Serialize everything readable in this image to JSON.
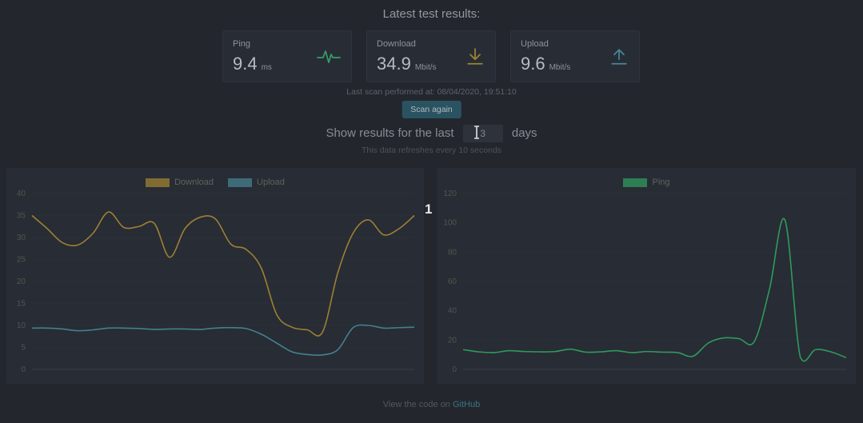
{
  "page": {
    "title": "Latest test results:",
    "last_scan": "Last scan performed at: 08/04/2020, 19:51:10",
    "scan_button": "Scan again",
    "filter_prefix": "Show results for the last",
    "filter_days_value": "3",
    "filter_suffix": "days",
    "refresh_note": "This data refreshes every 10 seconds",
    "annotation": "1",
    "footer_text": "View the code on",
    "footer_link": "GitHub"
  },
  "cards": [
    {
      "label": "Ping",
      "value": "9.4",
      "unit": "ms",
      "icon": "pulse-icon",
      "icon_color": "#35a065"
    },
    {
      "label": "Download",
      "value": "34.9",
      "unit": "Mbit/s",
      "icon": "download-icon",
      "icon_color": "#a08431"
    },
    {
      "label": "Upload",
      "value": "9.6",
      "unit": "Mbit/s",
      "icon": "upload-icon",
      "icon_color": "#46879a"
    }
  ],
  "colors": {
    "background": "#23272d",
    "panel": "#282c34",
    "download": "#9d8033",
    "upload": "#44808f",
    "ping": "#2f9a5e",
    "link": "#3c7484"
  },
  "chart_data": [
    {
      "type": "line",
      "title": "",
      "legend_position": "top",
      "x_axis_labels_visible": false,
      "grid": "faint-horizontal",
      "ylim": [
        0,
        40
      ],
      "yticks": [
        0,
        5,
        10,
        15,
        20,
        25,
        30,
        35,
        40
      ],
      "series": [
        {
          "name": "Download",
          "color": "#9d8033",
          "values": [
            35,
            32,
            28.8,
            28.3,
            31,
            35.8,
            32.3,
            32.5,
            33.2,
            25.5,
            32,
            34.6,
            34.2,
            28.5,
            27.3,
            23,
            12.5,
            9.6,
            9,
            8.5,
            22,
            31,
            34,
            30.6,
            32,
            35
          ]
        },
        {
          "name": "Upload",
          "color": "#44808f",
          "values": [
            9.4,
            9.4,
            9.2,
            8.8,
            9,
            9.4,
            9.4,
            9.3,
            9.1,
            9.2,
            9.2,
            9.1,
            9.4,
            9.5,
            9.3,
            8,
            6,
            4,
            3.4,
            3.3,
            4.5,
            9.5,
            10,
            9.4,
            9.5,
            9.6
          ]
        }
      ]
    },
    {
      "type": "line",
      "title": "",
      "legend_position": "top",
      "x_axis_labels_visible": false,
      "grid": "faint-horizontal",
      "ylim": [
        0,
        120
      ],
      "yticks": [
        0,
        20,
        40,
        60,
        80,
        100,
        120
      ],
      "series": [
        {
          "name": "Ping",
          "color": "#2f9a5e",
          "values": [
            13.5,
            12,
            11.5,
            12.8,
            12.2,
            12,
            12.2,
            13.8,
            11.8,
            12,
            12.8,
            11.5,
            12.2,
            11.8,
            11.5,
            9,
            18,
            21.5,
            21,
            19,
            55,
            102,
            8.6,
            13.5,
            12,
            8
          ]
        }
      ]
    }
  ]
}
